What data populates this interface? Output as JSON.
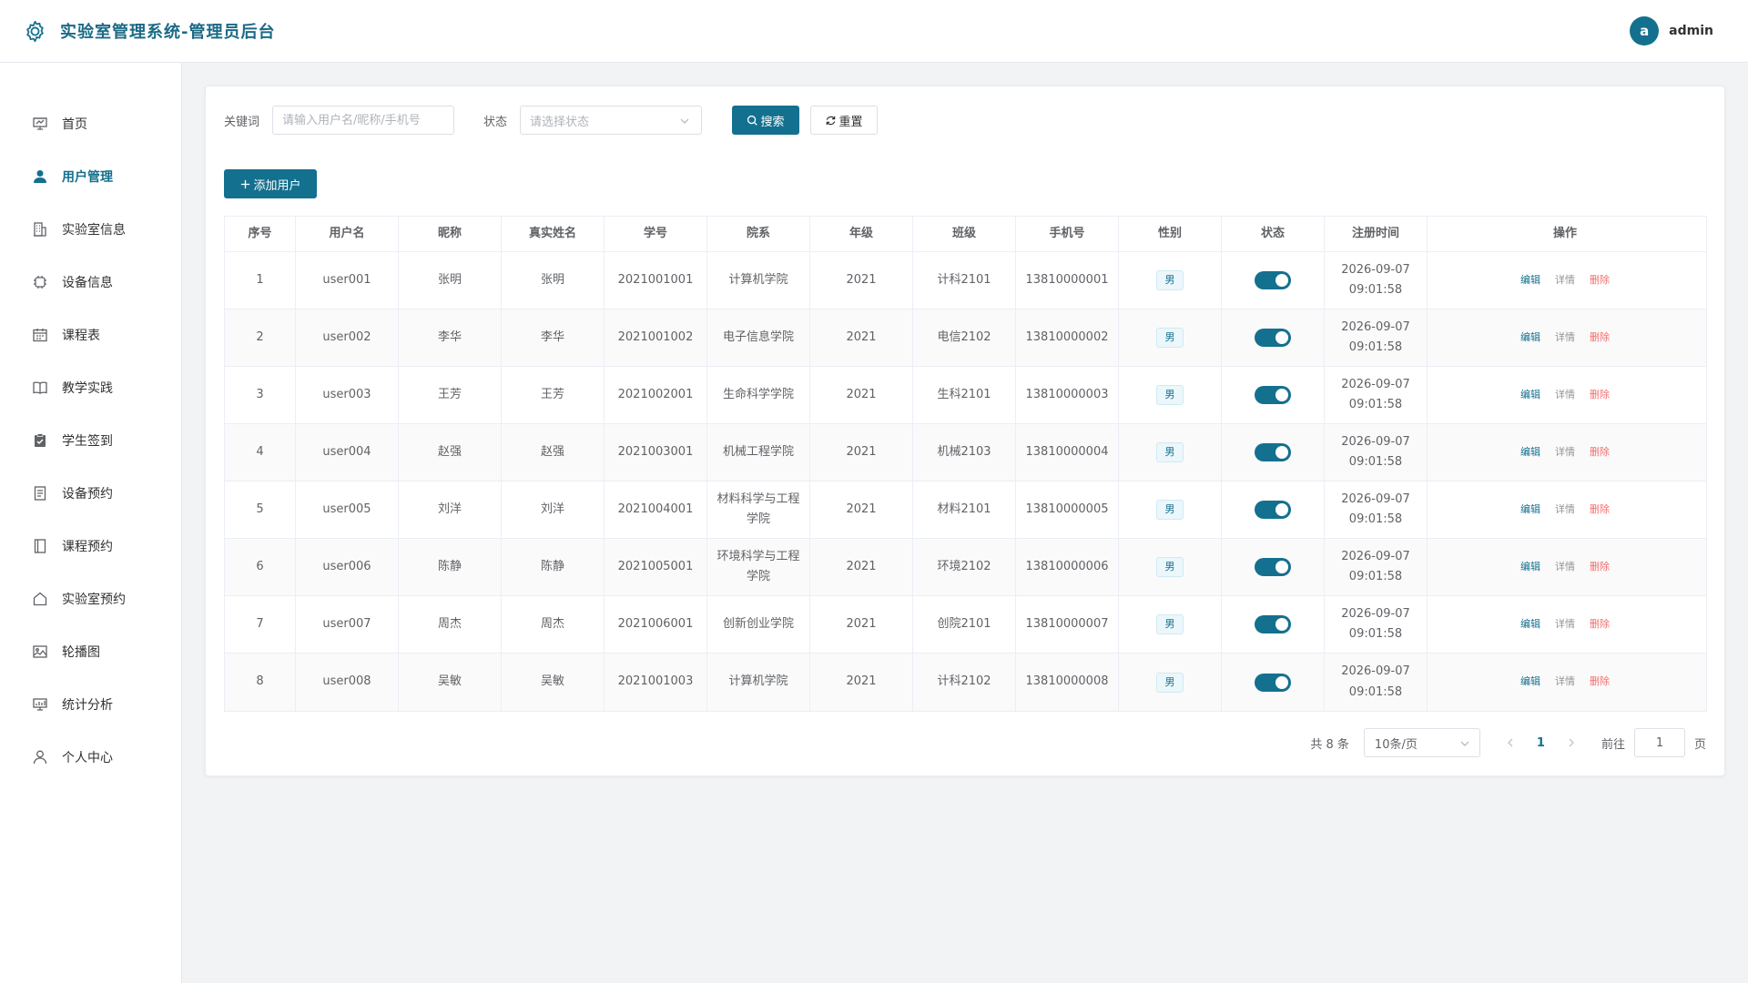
{
  "header": {
    "title": "实验室管理系统-管理员后台",
    "avatar_letter": "a",
    "username": "admin"
  },
  "colors": {
    "accent": "#14708f",
    "danger": "#f56c6c",
    "muted": "#909399"
  },
  "sidebar": {
    "items": [
      {
        "label": "首页",
        "icon": "dashboard-icon",
        "active": false
      },
      {
        "label": "用户管理",
        "icon": "user-icon",
        "active": true
      },
      {
        "label": "实验室信息",
        "icon": "building-icon",
        "active": false
      },
      {
        "label": "设备信息",
        "icon": "chip-icon",
        "active": false
      },
      {
        "label": "课程表",
        "icon": "calendar-icon",
        "active": false
      },
      {
        "label": "教学实践",
        "icon": "book-icon",
        "active": false
      },
      {
        "label": "学生签到",
        "icon": "clipboard-check-icon",
        "active": false
      },
      {
        "label": "设备预约",
        "icon": "document-icon",
        "active": false
      },
      {
        "label": "课程预约",
        "icon": "notebook-icon",
        "active": false
      },
      {
        "label": "实验室预约",
        "icon": "home-icon",
        "active": false
      },
      {
        "label": "轮播图",
        "icon": "picture-icon",
        "active": false
      },
      {
        "label": "统计分析",
        "icon": "chart-icon",
        "active": false
      },
      {
        "label": "个人中心",
        "icon": "person-icon",
        "active": false
      }
    ]
  },
  "filters": {
    "keyword_label": "关键词",
    "keyword_placeholder": "请输入用户名/昵称/手机号",
    "keyword_value": "",
    "status_label": "状态",
    "status_placeholder": "请选择状态",
    "search_label": "搜索",
    "reset_label": "重置"
  },
  "actions": {
    "add_user_label": "添加用户"
  },
  "table": {
    "columns": [
      "序号",
      "用户名",
      "昵称",
      "真实姓名",
      "学号",
      "院系",
      "年级",
      "班级",
      "手机号",
      "性别",
      "状态",
      "注册时间",
      "操作"
    ],
    "op_labels": {
      "edit": "编辑",
      "detail": "详情",
      "delete": "删除"
    },
    "rows": [
      {
        "no": "1",
        "username": "user001",
        "nickname": "张明",
        "realname": "张明",
        "student_id": "2021001001",
        "dept": "计算机学院",
        "grade": "2021",
        "class": "计科2101",
        "phone": "13810000001",
        "gender": "男",
        "enabled": true,
        "date": "2026-09-07",
        "time": "09:01:58"
      },
      {
        "no": "2",
        "username": "user002",
        "nickname": "李华",
        "realname": "李华",
        "student_id": "2021001002",
        "dept": "电子信息学院",
        "grade": "2021",
        "class": "电信2102",
        "phone": "13810000002",
        "gender": "男",
        "enabled": true,
        "date": "2026-09-07",
        "time": "09:01:58"
      },
      {
        "no": "3",
        "username": "user003",
        "nickname": "王芳",
        "realname": "王芳",
        "student_id": "2021002001",
        "dept": "生命科学学院",
        "grade": "2021",
        "class": "生科2101",
        "phone": "13810000003",
        "gender": "男",
        "enabled": true,
        "date": "2026-09-07",
        "time": "09:01:58"
      },
      {
        "no": "4",
        "username": "user004",
        "nickname": "赵强",
        "realname": "赵强",
        "student_id": "2021003001",
        "dept": "机械工程学院",
        "grade": "2021",
        "class": "机械2103",
        "phone": "13810000004",
        "gender": "男",
        "enabled": true,
        "date": "2026-09-07",
        "time": "09:01:58"
      },
      {
        "no": "5",
        "username": "user005",
        "nickname": "刘洋",
        "realname": "刘洋",
        "student_id": "2021004001",
        "dept": "材料科学与工程学院",
        "grade": "2021",
        "class": "材料2101",
        "phone": "13810000005",
        "gender": "男",
        "enabled": true,
        "date": "2026-09-07",
        "time": "09:01:58"
      },
      {
        "no": "6",
        "username": "user006",
        "nickname": "陈静",
        "realname": "陈静",
        "student_id": "2021005001",
        "dept": "环境科学与工程学院",
        "grade": "2021",
        "class": "环境2102",
        "phone": "13810000006",
        "gender": "男",
        "enabled": true,
        "date": "2026-09-07",
        "time": "09:01:58"
      },
      {
        "no": "7",
        "username": "user007",
        "nickname": "周杰",
        "realname": "周杰",
        "student_id": "2021006001",
        "dept": "创新创业学院",
        "grade": "2021",
        "class": "创院2101",
        "phone": "13810000007",
        "gender": "男",
        "enabled": true,
        "date": "2026-09-07",
        "time": "09:01:58"
      },
      {
        "no": "8",
        "username": "user008",
        "nickname": "吴敏",
        "realname": "吴敏",
        "student_id": "2021001003",
        "dept": "计算机学院",
        "grade": "2021",
        "class": "计科2102",
        "phone": "13810000008",
        "gender": "男",
        "enabled": true,
        "date": "2026-09-07",
        "time": "09:01:58"
      }
    ]
  },
  "pagination": {
    "total_text": "共 8 条",
    "page_size": "10条/页",
    "current_page": "1",
    "goto_label": "前往",
    "goto_value": "1",
    "page_suffix": "页"
  }
}
